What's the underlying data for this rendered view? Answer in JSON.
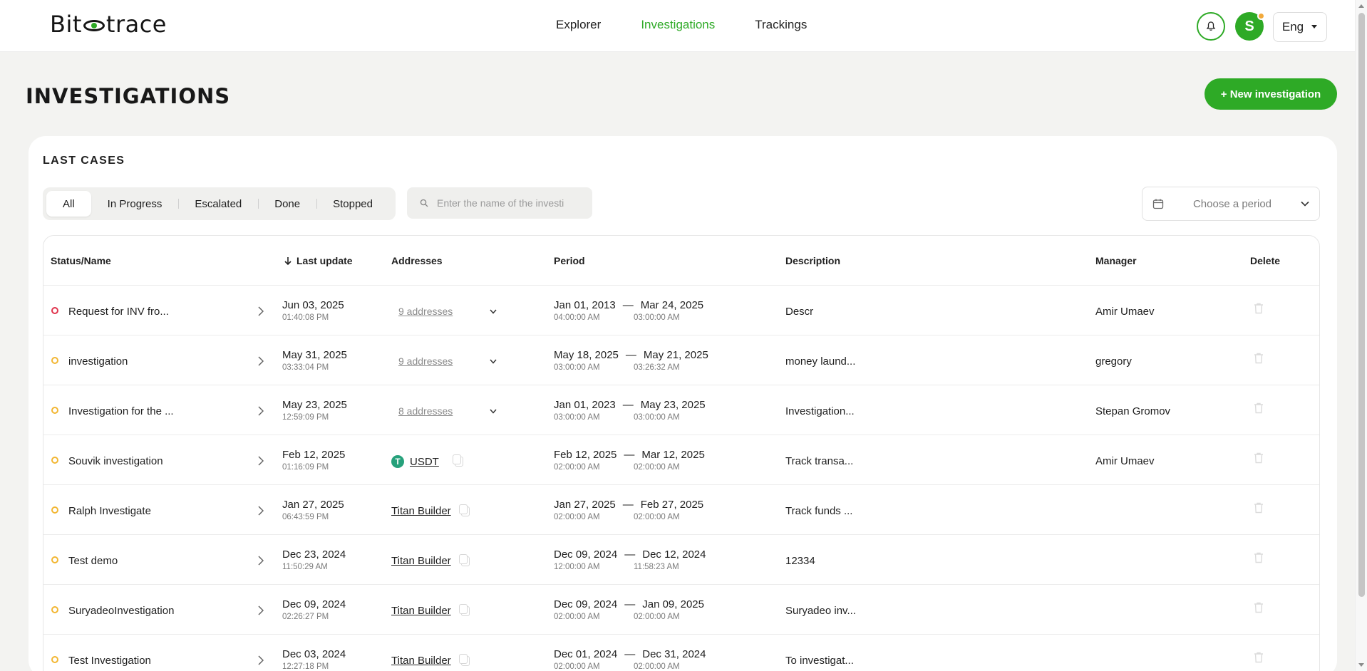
{
  "header": {
    "logo_left": "Bit",
    "logo_right": "trace",
    "nav": [
      {
        "label": "Explorer",
        "active": false
      },
      {
        "label": "Investigations",
        "active": true
      },
      {
        "label": "Trackings",
        "active": false
      }
    ],
    "avatar_letter": "S",
    "language": "Eng"
  },
  "page": {
    "title": "INVESTIGATIONS",
    "new_button": "+ New investigation"
  },
  "cases": {
    "title": "LAST CASES",
    "filters": [
      "All",
      "In Progress",
      "Escalated",
      "Done",
      "Stopped"
    ],
    "active_filter": "All",
    "search_placeholder": "Enter the name of the investi",
    "period_placeholder": "Choose a period",
    "columns": {
      "status_name": "Status/Name",
      "last_update": "Last update",
      "addresses": "Addresses",
      "period": "Period",
      "description": "Description",
      "manager": "Manager",
      "delete": "Delete"
    },
    "rows": [
      {
        "status": "red",
        "name": "Request for INV fro...",
        "date": "Jun 03, 2025",
        "time": "01:40:08 PM",
        "addresses": "9 addresses",
        "addr_type": "count",
        "period_from": "Jan 01, 2013",
        "period_to": "Mar 24, 2025",
        "time_from": "04:00:00 AM",
        "time_to": "03:00:00 AM",
        "description": "Descr",
        "manager": "Amir Umaev"
      },
      {
        "status": "yellow",
        "name": "investigation",
        "date": "May 31, 2025",
        "time": "03:33:04 PM",
        "addresses": "9 addresses",
        "addr_type": "count",
        "period_from": "May 18, 2025",
        "period_to": "May 21, 2025",
        "time_from": "03:00:00 AM",
        "time_to": "03:26:32 AM",
        "description": "money laund...",
        "manager": "gregory"
      },
      {
        "status": "yellow",
        "name": "Investigation for the ...",
        "date": "May 23, 2025",
        "time": "12:59:09 PM",
        "addresses": "8 addresses",
        "addr_type": "count",
        "period_from": "Jan 01, 2023",
        "period_to": "May 23, 2025",
        "time_from": "03:00:00 AM",
        "time_to": "03:00:00 AM",
        "description": "Investigation...",
        "manager": "Stepan Gromov"
      },
      {
        "status": "yellow",
        "name": "Souvik investigation",
        "date": "Feb 12, 2025",
        "time": "01:16:09 PM",
        "addresses": "USDT",
        "addr_type": "token",
        "period_from": "Feb 12, 2025",
        "period_to": "Mar 12, 2025",
        "time_from": "02:00:00 AM",
        "time_to": "02:00:00 AM",
        "description": "Track transa...",
        "manager": "Amir Umaev"
      },
      {
        "status": "yellow",
        "name": "Ralph Investigate",
        "date": "Jan 27, 2025",
        "time": "06:43:59 PM",
        "addresses": "Titan Builder",
        "addr_type": "link",
        "period_from": "Jan 27, 2025",
        "period_to": "Feb 27, 2025",
        "time_from": "02:00:00 AM",
        "time_to": "02:00:00 AM",
        "description": "Track funds ...",
        "manager": ""
      },
      {
        "status": "yellow",
        "name": "Test demo",
        "date": "Dec 23, 2024",
        "time": "11:50:29 AM",
        "addresses": "Titan Builder",
        "addr_type": "link",
        "period_from": "Dec 09, 2024",
        "period_to": "Dec 12, 2024",
        "time_from": "12:00:00 AM",
        "time_to": "11:58:23 AM",
        "description": "12334",
        "manager": ""
      },
      {
        "status": "yellow",
        "name": "SuryadeoInvestigation",
        "date": "Dec 09, 2024",
        "time": "02:26:27 PM",
        "addresses": "Titan Builder",
        "addr_type": "link",
        "period_from": "Dec 09, 2024",
        "period_to": "Jan 09, 2025",
        "time_from": "02:00:00 AM",
        "time_to": "02:00:00 AM",
        "description": "Suryadeo inv...",
        "manager": ""
      },
      {
        "status": "yellow",
        "name": "Test Investigation",
        "date": "Dec 03, 2024",
        "time": "12:27:18 PM",
        "addresses": "Titan Builder",
        "addr_type": "link",
        "period_from": "Dec 01, 2024",
        "period_to": "Dec 31, 2024",
        "time_from": "02:00:00 AM",
        "time_to": "02:00:00 AM",
        "description": "To investigat...",
        "manager": ""
      }
    ]
  },
  "colors": {
    "accent": "#2eaa26",
    "status_red": "#e0334c",
    "status_yellow": "#f2b632",
    "usdt": "#26a17b"
  }
}
